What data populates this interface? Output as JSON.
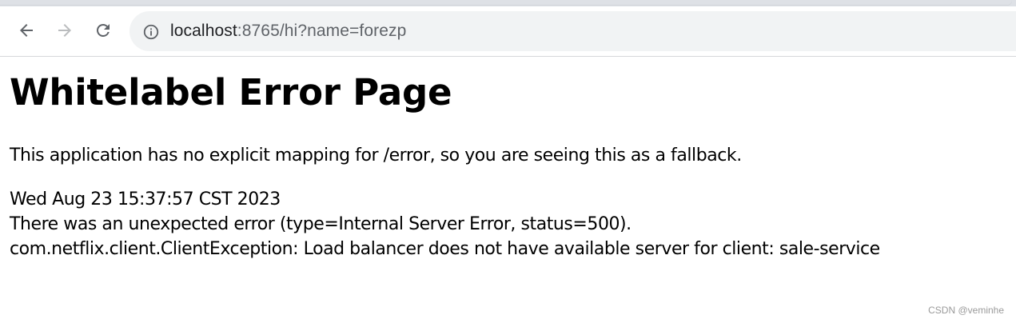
{
  "browser": {
    "address_bar": {
      "url_host": "localhost",
      "url_rest": ":8765/hi?name=forezp"
    },
    "icons": {
      "back": "arrow-left-icon",
      "forward": "arrow-right-icon",
      "reload": "reload-icon",
      "site_info": "info-circle-icon"
    }
  },
  "page": {
    "title": "Whitelabel Error Page",
    "fallback_message": "This application has no explicit mapping for /error, so you are seeing this as a fallback.",
    "timestamp": "Wed Aug 23 15:37:57 CST 2023",
    "error_summary": "There was an unexpected error (type=Internal Server Error, status=500).",
    "exception_message": "com.netflix.client.ClientException: Load balancer does not have available server for client: sale-service"
  },
  "watermark": "CSDN @veminhe"
}
